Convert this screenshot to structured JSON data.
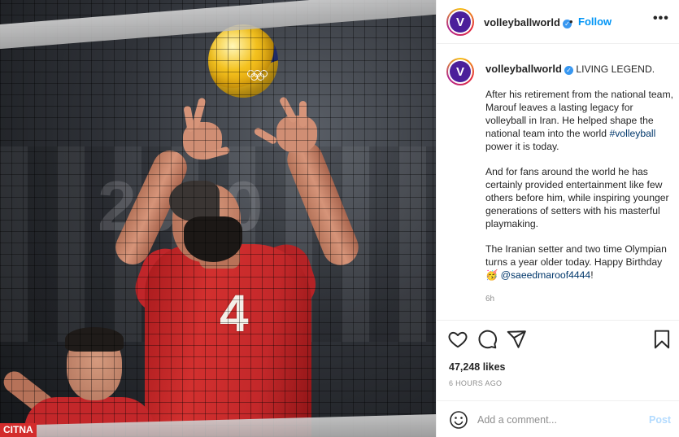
{
  "post": {
    "watermark": "CITNA",
    "photo_year_text": "2020"
  },
  "header": {
    "avatar_letter": "V",
    "username": "volleyballworld",
    "verified_mark": "✓",
    "separator": "•",
    "follow_label": "Follow",
    "more_label": "•••"
  },
  "caption": {
    "avatar_letter": "V",
    "username": "volleyballworld",
    "verified_mark": "✓",
    "headline": "LIVING LEGEND.",
    "para1_a": "After his retirement from the national team, Marouf leaves a lasting legacy for volleyball in Iran. He helped shape the national team into the world ",
    "para1_hashtag": "#volleyball",
    "para1_b": " power it is today.",
    "para2": "And for fans around the world he has certainly provided entertainment like few others before him, while inspiring younger generations of setters with his masterful playmaking.",
    "para3_a": "The Iranian setter and two time Olympian turns a year older today. Happy Birthday ",
    "para3_emoji": "🥳",
    "para3_mention": "@saeedmaroof4444",
    "para3_b": "!",
    "time": "6h"
  },
  "actions": {
    "icons": [
      "heart-icon",
      "comment-icon",
      "share-icon",
      "bookmark-icon"
    ],
    "likes": "47,248 likes",
    "time_ago": "6 HOURS AGO"
  },
  "comment": {
    "placeholder": "Add a comment...",
    "post_label": "Post"
  },
  "colors": {
    "brand_purple": "#4b1f9a",
    "link_blue": "#0095f6",
    "jersey_red": "#c3282a"
  }
}
